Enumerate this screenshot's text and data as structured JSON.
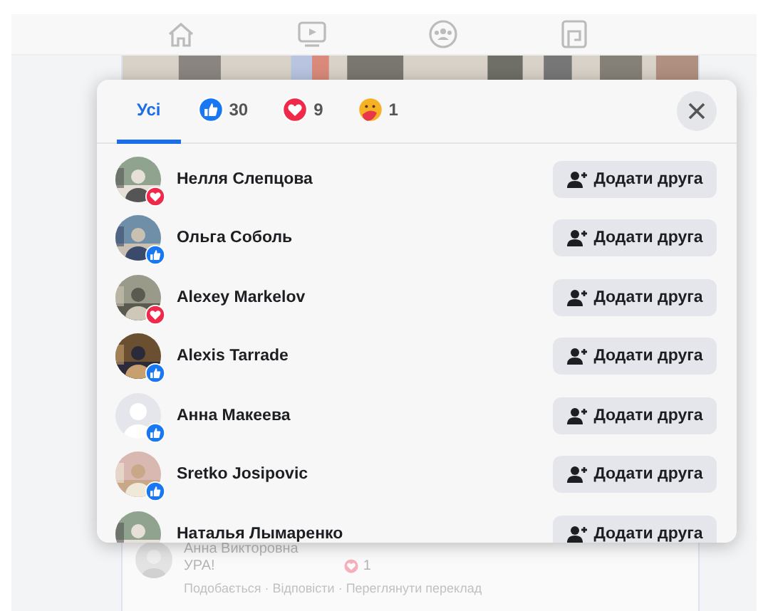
{
  "nav": {
    "items": [
      {
        "kind": "home"
      },
      {
        "kind": "video"
      },
      {
        "kind": "groups"
      },
      {
        "kind": "gaming"
      }
    ]
  },
  "dialog": {
    "tabs": [
      {
        "kind": "all",
        "label": "Усі",
        "selected": true
      },
      {
        "kind": "like",
        "count": "30",
        "selected": false
      },
      {
        "kind": "love",
        "count": "9",
        "selected": false
      },
      {
        "kind": "care",
        "count": "1",
        "selected": false
      }
    ],
    "people": [
      {
        "name": "Нелля Слепцова",
        "reaction": {
          "kind": "love"
        },
        "button": "Додати друга"
      },
      {
        "name": "Ольга Соболь",
        "reaction": {
          "kind": "like"
        },
        "button": "Додати друга"
      },
      {
        "name": "Alexey Markelov",
        "reaction": {
          "kind": "love"
        },
        "button": "Додати друга"
      },
      {
        "name": "Alexis Tarrade",
        "reaction": {
          "kind": "like"
        },
        "button": "Додати друга"
      },
      {
        "name": "Анна Макеева",
        "reaction": {
          "kind": "like"
        },
        "avatar": {
          "kind": "default"
        },
        "button": "Додати друга"
      },
      {
        "name": "Sretko Josipovic",
        "reaction": {
          "kind": "like"
        },
        "button": "Додати друга"
      },
      {
        "name": "Наталья Лымаренко",
        "button": "Додати друга"
      }
    ]
  },
  "comment": {
    "author": "Анна Викторовна",
    "text": "УРА!",
    "reactions": "1",
    "actions": "Подобається · Відповісти · Переглянути переклад"
  }
}
